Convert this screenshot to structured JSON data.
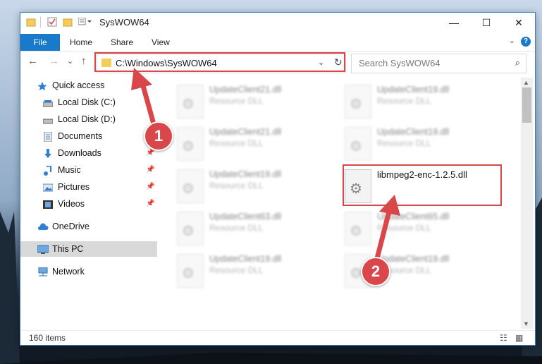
{
  "window": {
    "title": "SysWOW64",
    "minimize": "—",
    "maximize": "☐",
    "close": "✕"
  },
  "ribbon": {
    "file_tab": "File",
    "tabs": [
      "Home",
      "Share",
      "View"
    ],
    "help": "?"
  },
  "address_bar": {
    "path": "C:\\Windows\\SysWOW64",
    "dropdown_glyph": "⌄",
    "refresh_glyph": "↻"
  },
  "search": {
    "placeholder": "Search SysWOW64"
  },
  "nav_buttons": {
    "back": "←",
    "forward": "→",
    "recent": "⌄",
    "up": "↑"
  },
  "nav_pane": {
    "items": [
      {
        "label": "Quick access",
        "icon": "star-icon",
        "pinned": false
      },
      {
        "label": "Local Disk (C:)",
        "icon": "drive-icon",
        "pinned": false
      },
      {
        "label": "Local Disk (D:)",
        "icon": "drive-icon",
        "pinned": false
      },
      {
        "label": "Documents",
        "icon": "document-icon",
        "pinned": false
      },
      {
        "label": "Downloads",
        "icon": "download-icon",
        "pinned": true
      },
      {
        "label": "Music",
        "icon": "music-icon",
        "pinned": true
      },
      {
        "label": "Pictures",
        "icon": "pictures-icon",
        "pinned": true
      },
      {
        "label": "Videos",
        "icon": "video-icon",
        "pinned": true
      },
      {
        "label": "OneDrive",
        "icon": "cloud-icon",
        "pinned": false
      },
      {
        "label": "This PC",
        "icon": "computer-icon",
        "pinned": false
      },
      {
        "label": "Network",
        "icon": "network-icon",
        "pinned": false
      }
    ],
    "pin_glyph": "📌"
  },
  "files": [
    {
      "name": "UpdateClient21.dll",
      "type": "Resource DLL"
    },
    {
      "name": "UpdateClient19.dll",
      "type": "Resource DLL"
    },
    {
      "name": "UpdateClient21.dll",
      "type": "Resource DLL"
    },
    {
      "name": "UpdateClient19.dll",
      "type": "Resource DLL"
    },
    {
      "name": "UpdateClient19.dll",
      "type": "Resource DLL"
    },
    {
      "name": "libmpeg2-enc-1.2.5.dll",
      "type": ""
    },
    {
      "name": "UpdateClient63.dll",
      "type": "Resource DLL"
    },
    {
      "name": "UpdateClient65.dll",
      "type": "Resource DLL"
    },
    {
      "name": "UpdateClient19.dll",
      "type": "Resource DLL"
    },
    {
      "name": "UpdateClient19.dll",
      "type": "Resource DLL"
    }
  ],
  "status": {
    "item_count": "160 items"
  },
  "annotations": {
    "step1": "1",
    "step2": "2",
    "color": "#d9474a"
  },
  "colors": {
    "accent": "#1979ca",
    "highlight": "#d9474a"
  }
}
